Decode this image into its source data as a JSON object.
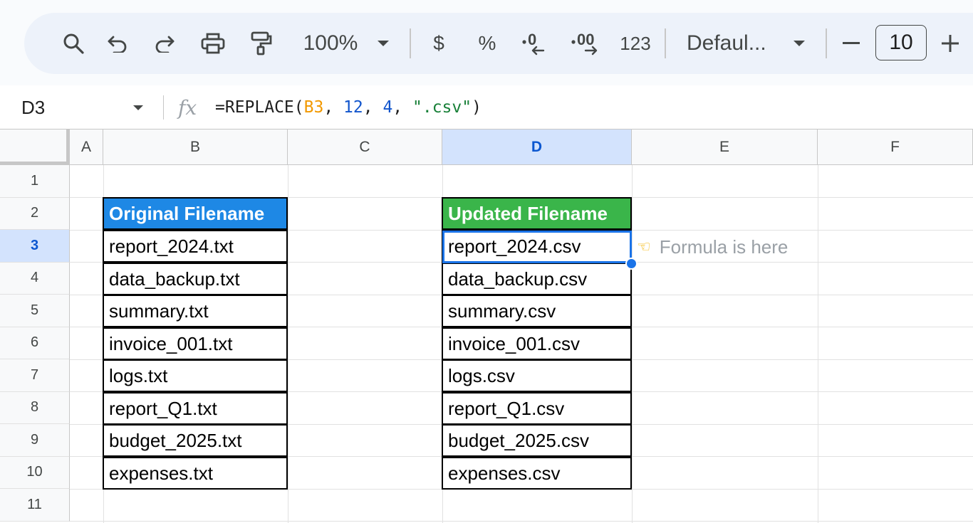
{
  "toolbar": {
    "zoom": "100%",
    "currency_label": "$",
    "percent_label": "%",
    "number_format_label": "123",
    "font_name": "Defaul...",
    "font_size": "10",
    "icons": [
      "search-icon",
      "undo-icon",
      "redo-icon",
      "print-icon",
      "paint-format-icon",
      "caret-down-icon",
      "decrease-decimal-icon",
      "increase-decimal-icon",
      "minus-icon",
      "plus-icon"
    ]
  },
  "formula_bar": {
    "cell_ref": "D3",
    "fx_label": "fx",
    "formula_parts": {
      "prefix": "=REPLACE(",
      "ref": "B3",
      "sep1": ", ",
      "arg2": "12",
      "sep2": ", ",
      "arg3": "4",
      "sep3": ", ",
      "arg4": "\".csv\"",
      "suffix": ")"
    }
  },
  "grid": {
    "columns": [
      "A",
      "B",
      "C",
      "D",
      "E",
      "F"
    ],
    "rows": [
      "1",
      "2",
      "3",
      "4",
      "5",
      "6",
      "7",
      "8",
      "9",
      "10",
      "11"
    ],
    "selected_column": "D",
    "selected_row": "3"
  },
  "original_table": {
    "header": "Original Filename",
    "header_color": "#1e88e5",
    "values": [
      "report_2024.txt",
      "data_backup.txt",
      "summary.txt",
      "invoice_001.txt",
      "logs.txt",
      "report_Q1.txt",
      "budget_2025.txt",
      "expenses.txt"
    ]
  },
  "updated_table": {
    "header": "Updated Filename",
    "header_color": "#3ab54a",
    "values": [
      "report_2024.csv",
      "data_backup.csv",
      "summary.csv",
      "invoice_001.csv",
      "logs.csv",
      "report_Q1.csv",
      "budget_2025.csv",
      "expenses.csv"
    ]
  },
  "annotation": {
    "text": "Formula is here",
    "icon": "pointing-hand-icon"
  }
}
